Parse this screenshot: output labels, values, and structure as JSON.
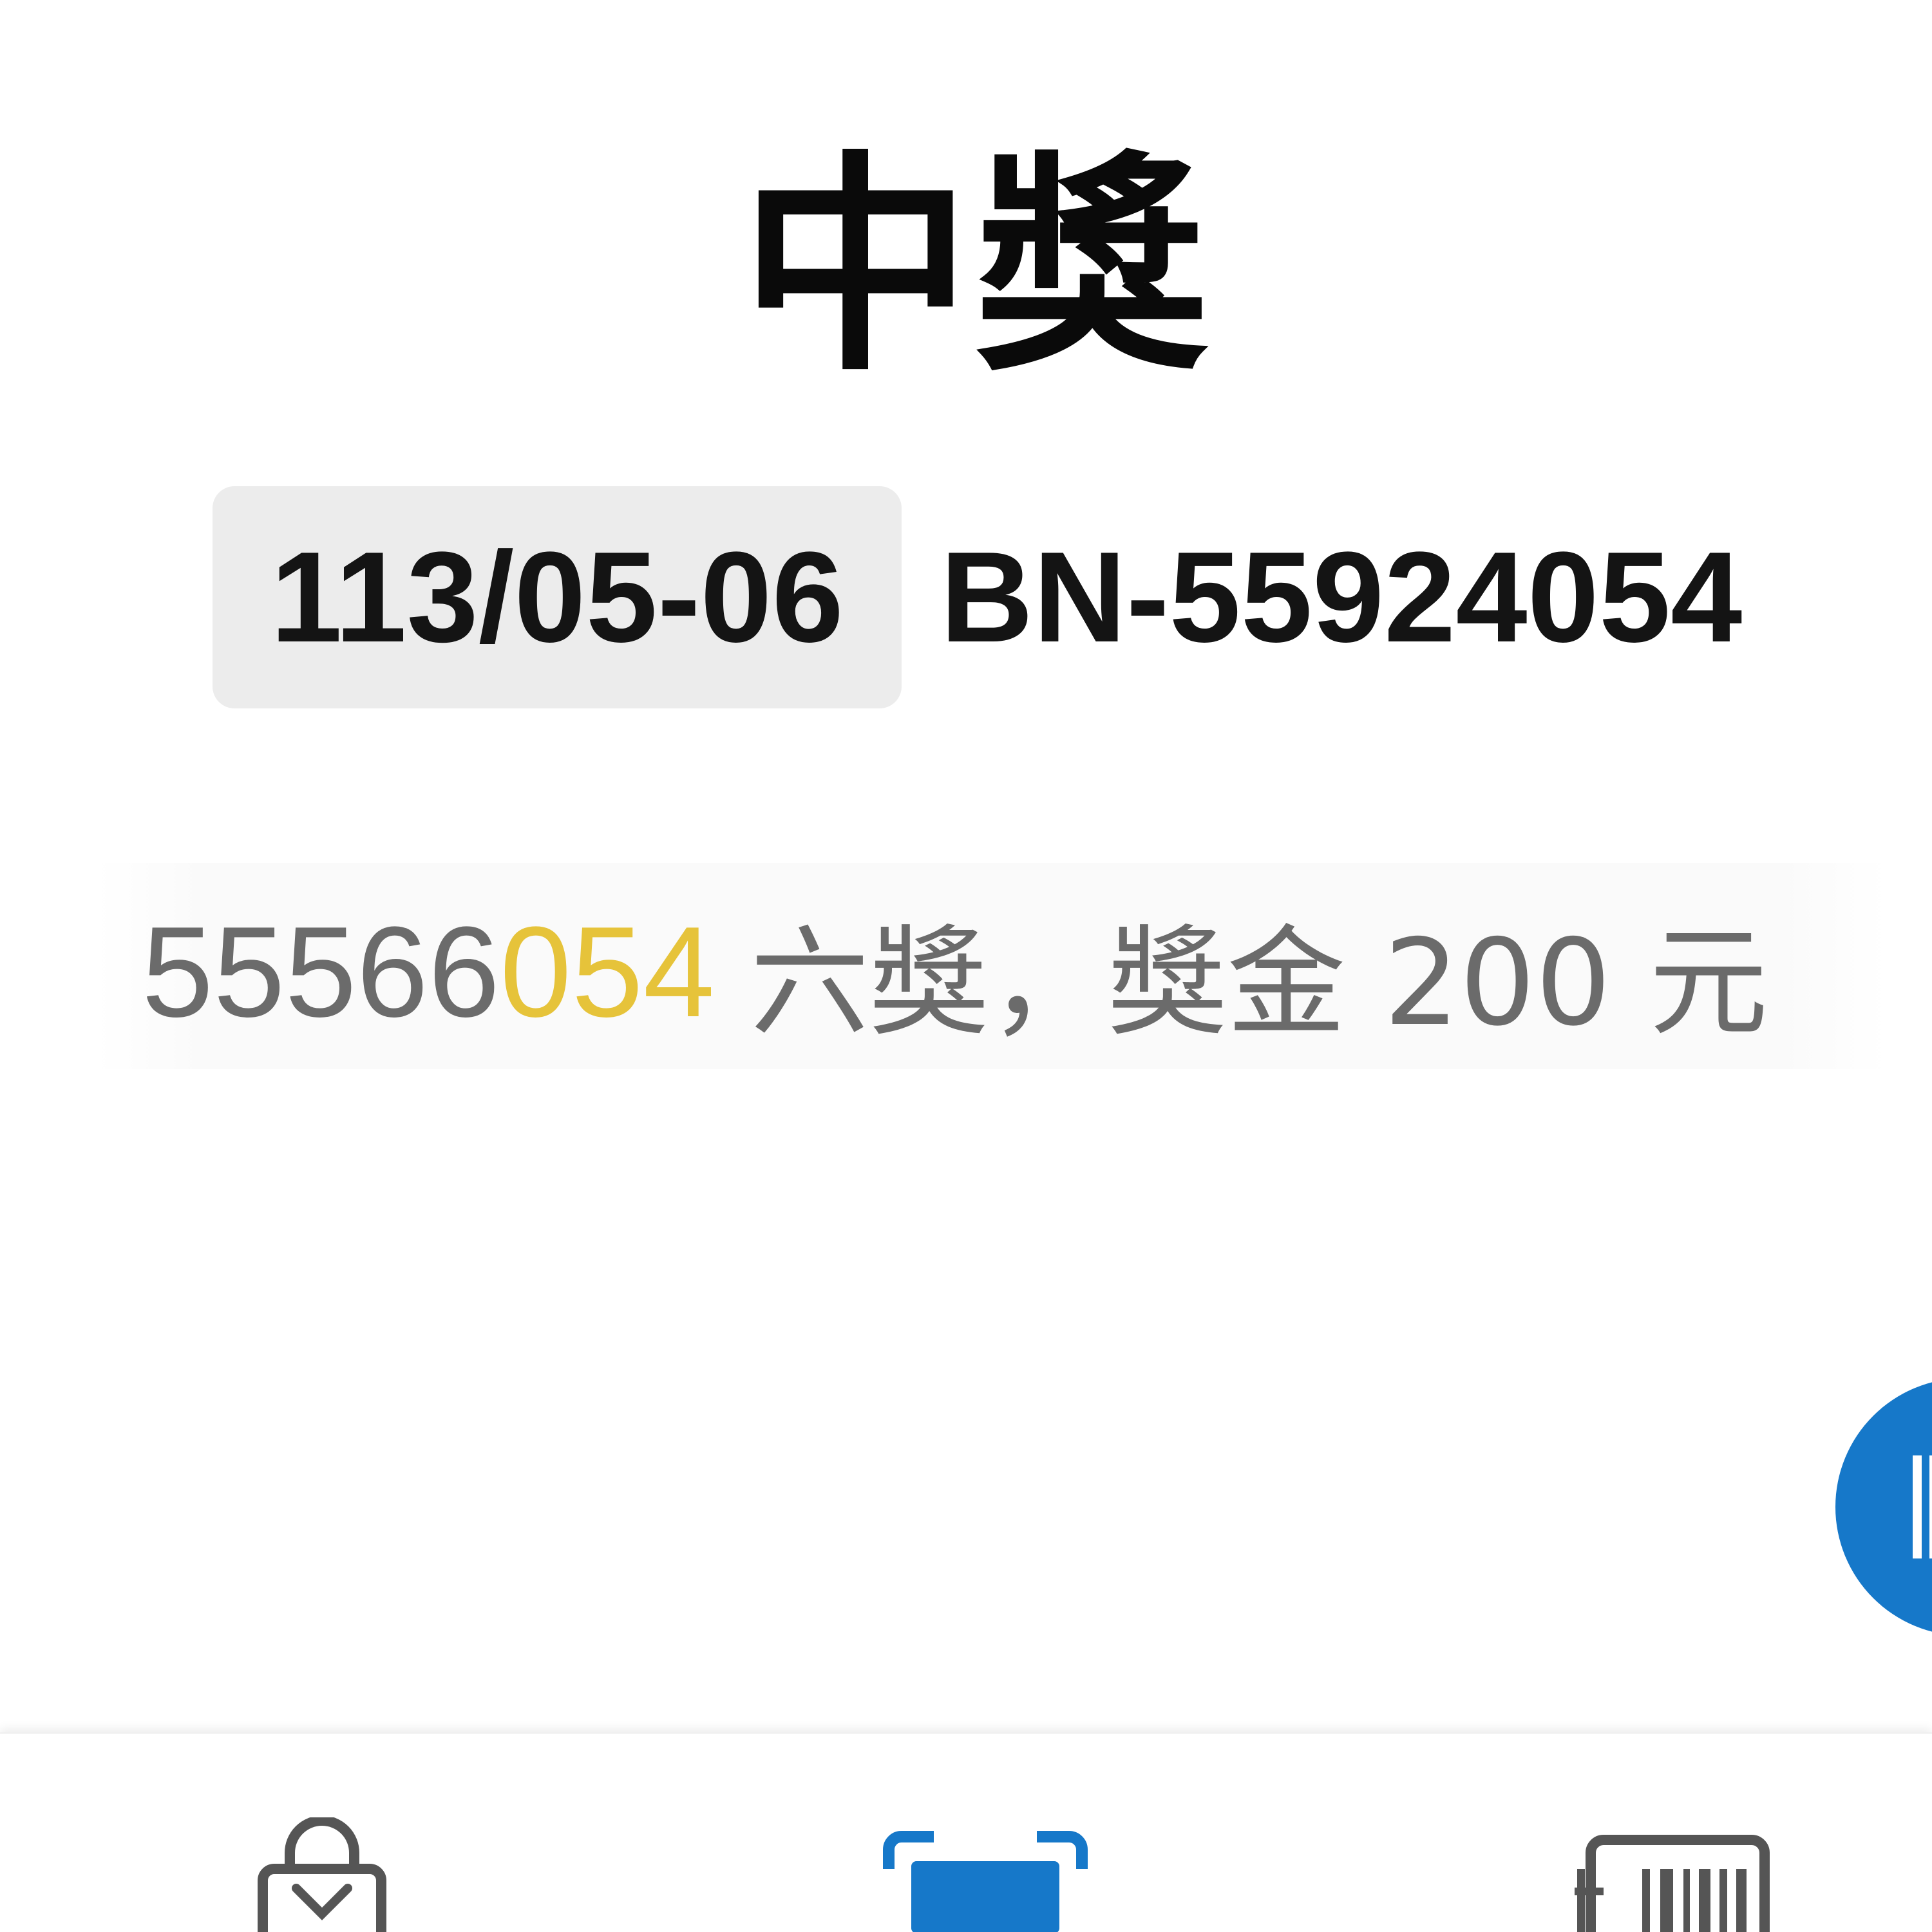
{
  "title": "中獎",
  "ticket": {
    "period": "113/05-06",
    "invoice_number": "BN-55924054"
  },
  "result": {
    "number_prefix": "55566",
    "number_matched": "054",
    "prize": "六獎，獎金 200 元"
  },
  "colors": {
    "matched_digits": "#e6c33a",
    "active_tab": "#1678c9",
    "fab": "#1678c9"
  },
  "nav": {
    "items": [
      {
        "icon": "shopping-bag-icon",
        "active": false
      },
      {
        "icon": "scan-icon",
        "active": true
      },
      {
        "icon": "barcode-receipt-icon",
        "active": false
      }
    ]
  }
}
